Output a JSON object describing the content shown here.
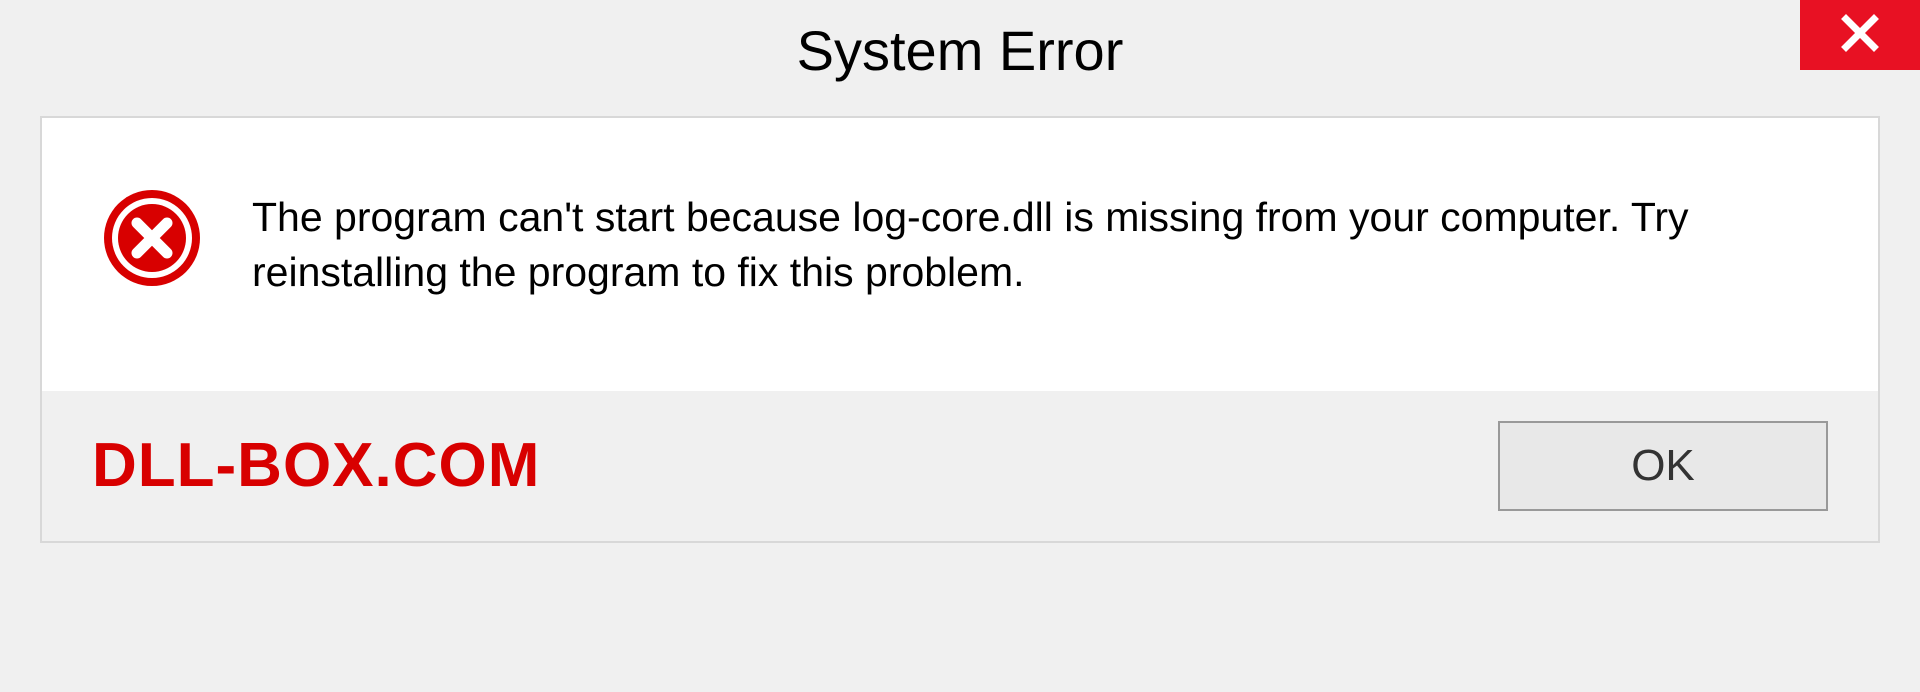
{
  "dialog": {
    "title": "System Error",
    "message": "The program can't start because log-core.dll is missing from your computer. Try reinstalling the program to fix this problem.",
    "ok_label": "OK"
  },
  "watermark": {
    "text": "DLL-BOX.COM"
  }
}
